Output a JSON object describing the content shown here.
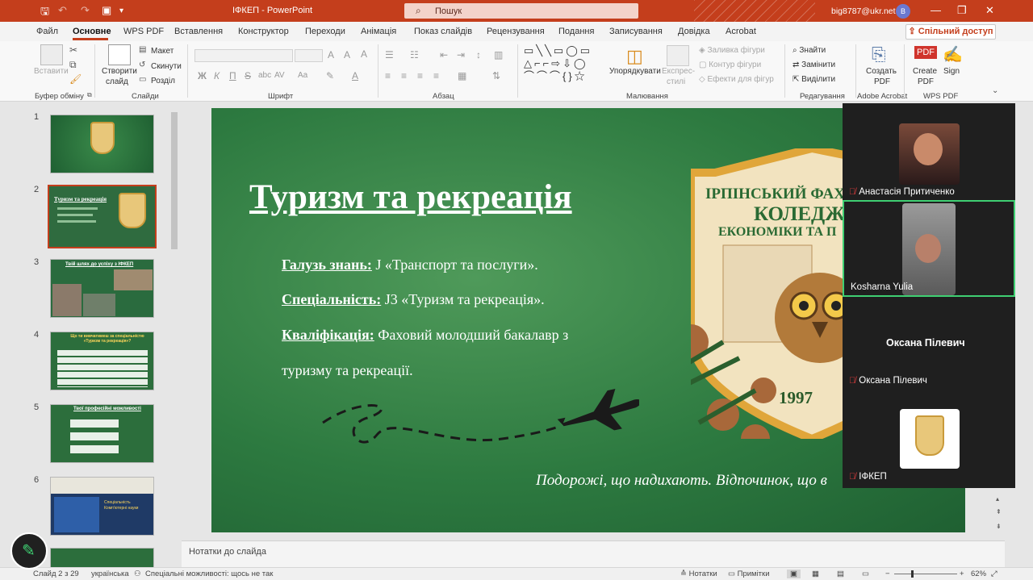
{
  "titlebar": {
    "app_title": "ІФКЕП  -  PowerPoint",
    "search_placeholder": "Пошук",
    "user_email": "big8787@ukr.net",
    "user_initial": "B",
    "icons": [
      "save-icon",
      "undo-icon",
      "redo-icon",
      "slideshow-icon",
      "customize-icon"
    ]
  },
  "tabs": [
    "Файл",
    "Основне",
    "WPS PDF",
    "Вставлення",
    "Конструктор",
    "Переходи",
    "Анімація",
    "Показ слайдів",
    "Рецензування",
    "Подання",
    "Записування",
    "Довідка",
    "Acrobat"
  ],
  "active_tab": "Основне",
  "share_button": "Спільний доступ",
  "ribbon": {
    "clipboard": {
      "paste": "Вставити",
      "label": "Буфер обміну"
    },
    "slides": {
      "new_slide_1": "Створити",
      "new_slide_2": "слайд",
      "layout": "Макет",
      "reset": "Скинути",
      "sections": "Розділ",
      "label": "Слайди"
    },
    "font": {
      "bold": "Ж",
      "italic": "К",
      "underline": "П",
      "strike": "S",
      "shadow": "abc",
      "spacing": "AV",
      "case": "Aa",
      "label": "Шрифт"
    },
    "paragraph": {
      "label": "Абзац"
    },
    "drawing": {
      "arrange_1": "Упорядкувати",
      "styles_1": "Експрес-",
      "styles_2": "стилі",
      "fill": "Заливка фігури",
      "outline": "Контур фігури",
      "effects": "Ефекти для фігур",
      "label": "Малювання"
    },
    "editing": {
      "find": "Знайти",
      "replace": "Замінити",
      "select": "Виділити",
      "label": "Редагування"
    },
    "acrobat": {
      "create_1": "Создать",
      "create_2": "PDF",
      "label": "Adobe Acrobat"
    },
    "wps": {
      "create_1": "Create",
      "create_2": "PDF",
      "sign": "Sign",
      "label": "WPS PDF"
    }
  },
  "thumbnails": [
    {
      "num": "1"
    },
    {
      "num": "2",
      "title": "Туризм та рекреація"
    },
    {
      "num": "3",
      "title": "Твій шлях до успіху з ІФКЕП"
    },
    {
      "num": "4",
      "title": "Що ти вивчатимеш за спеціальністю «Туризм та рекреація»?"
    },
    {
      "num": "5",
      "title": "Твої професійні можливості"
    },
    {
      "num": "6",
      "title": "Спеціальність Комп'ютерні науки"
    }
  ],
  "slide": {
    "title": "Туризм та рекреація",
    "rows": [
      {
        "label": "Галузь знань:",
        "value": " J «Транспорт та послуги»."
      },
      {
        "label": "Спеціальність:",
        "value": " J3 «Туризм та рекреація»."
      },
      {
        "label": "Кваліфікація:",
        "value": " Фаховий молодший бакалавр з"
      },
      {
        "label": "",
        "value": "туризму та рекреації."
      }
    ],
    "footer": "Подорожі, що надихають. Відпочинок, що в",
    "emblem_line1": "ІРПІНСЬКИЙ ФАХ",
    "emblem_line2": "КОЛЕДЖ",
    "emblem_line3": "ЕКОНОМІКИ ТА П",
    "emblem_year": "1997"
  },
  "notes_placeholder": "Нотатки до слайда",
  "statusbar": {
    "slide_count": "Слайд 2 з 29",
    "language": "українська",
    "accessibility": "Спеціальні можливості: щось не так",
    "notes": "Нотатки",
    "comments": "Примітки",
    "zoom": "62%"
  },
  "participants": [
    {
      "name": "Анастасія Притиченко",
      "muted": true,
      "has_video": true
    },
    {
      "name": "Kosharna Yulia",
      "muted": false,
      "has_video": true,
      "active_speaker": true
    },
    {
      "name": "Оксана Пілевич",
      "muted": true,
      "has_video": false,
      "display_name": "Оксана Пілевич"
    },
    {
      "name": "ІФКЕП",
      "muted": true,
      "has_video": true
    }
  ],
  "colors": {
    "accent": "#c43e1c",
    "slide_green": "#2d7a40",
    "speaker_border": "#3fcf72"
  }
}
